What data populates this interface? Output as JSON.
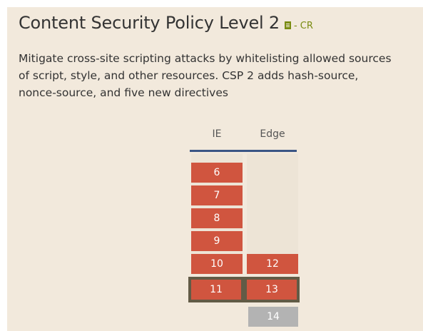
{
  "feature": {
    "title": "Content Security Policy Level 2",
    "spec_status": "- CR",
    "spec_icon": "spec-document-icon",
    "description_lines": [
      "Mitigate cross-site scripting attacks by whitelisting allowed sources",
      "of script, style, and other resources. CSP 2 adds hash-source,",
      "nonce-source, and five new directives"
    ]
  },
  "browsers": {
    "ie": {
      "name": "IE",
      "versions": [
        "6",
        "7",
        "8",
        "9",
        "10"
      ],
      "current": "11"
    },
    "edge": {
      "name": "Edge",
      "versions": [
        "12"
      ],
      "current": "13",
      "future": [
        "14"
      ]
    }
  },
  "colors": {
    "panel_background": "#f2e9dc",
    "unsupported": "#d0553f",
    "future": "#b3b3b3",
    "current_border": "#625b46",
    "header_rule": "#3a5585",
    "status_green": "#7a8c12"
  }
}
